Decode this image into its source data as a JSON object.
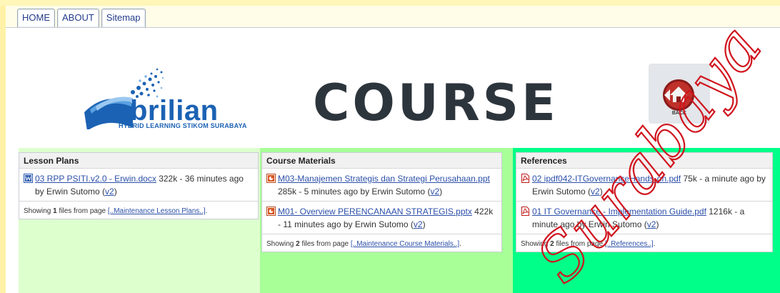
{
  "nav": {
    "tabs": [
      {
        "label": "HOME"
      },
      {
        "label": "ABOUT"
      },
      {
        "label": "Sitemap"
      }
    ]
  },
  "header": {
    "logo": {
      "name": "brilian",
      "subtitle": "HYBRID LEARNING STIKOM SURABAYA"
    },
    "title": "COURSE",
    "back_label": "BACK"
  },
  "columns": [
    {
      "heading": "Lesson Plans",
      "files": [
        {
          "icon": "word-doc-icon",
          "name": "03 RPP PSITI.v2.0 - Erwin.docx",
          "meta": " 322k - 36 minutes ago by Erwin Sutomo (",
          "version": "v2",
          "meta_end": ")"
        }
      ],
      "showing": {
        "prefix": "Showing ",
        "count": "1",
        "middle": " files from page ",
        "link": "[..Maintenance Lesson Plans..]",
        "suffix": "."
      }
    },
    {
      "heading": "Course Materials",
      "files": [
        {
          "icon": "powerpoint-icon",
          "name": "M03-Manajemen Strategis dan Strategi Perusahaan.ppt",
          "meta": " 285k - 5 minutes ago by Erwin Sutomo (",
          "version": "v2",
          "meta_end": ")"
        },
        {
          "icon": "powerpoint-icon",
          "name": "M01- Overview PERENCANAAN STRATEGIS.pptx",
          "meta": " 422k - 11 minutes ago by Erwin Sutomo (",
          "version": "v2",
          "meta_end": ")"
        }
      ],
      "showing": {
        "prefix": "Showing ",
        "count": "2",
        "middle": " files from page ",
        "link": "[..Maintenance Course Materials..]",
        "suffix": "."
      }
    },
    {
      "heading": "References",
      "files": [
        {
          "icon": "pdf-icon",
          "name": "02 ipdf042-ITGovernanceHands-on.pdf",
          "meta": " 75k - a minute ago by Erwin Sutomo (",
          "version": "v2",
          "meta_end": ")"
        },
        {
          "icon": "pdf-icon",
          "name": "01 IT Governance - Implementation Guide.pdf",
          "meta": " 1216k - a minute ago by Erwin Sutomo (",
          "version": "v2",
          "meta_end": ")"
        }
      ],
      "showing": {
        "prefix": "Showing ",
        "count": "2",
        "middle": " files from page ",
        "link": "[..References..]",
        "suffix": "."
      }
    }
  ],
  "watermark": "Surabaya",
  "colors": {
    "lesson_bg": "#ddffce",
    "materials_bg": "#a8ff98",
    "references_bg": "#00ff88",
    "link": "#2b4fa8",
    "watermark": "#d0141e"
  }
}
